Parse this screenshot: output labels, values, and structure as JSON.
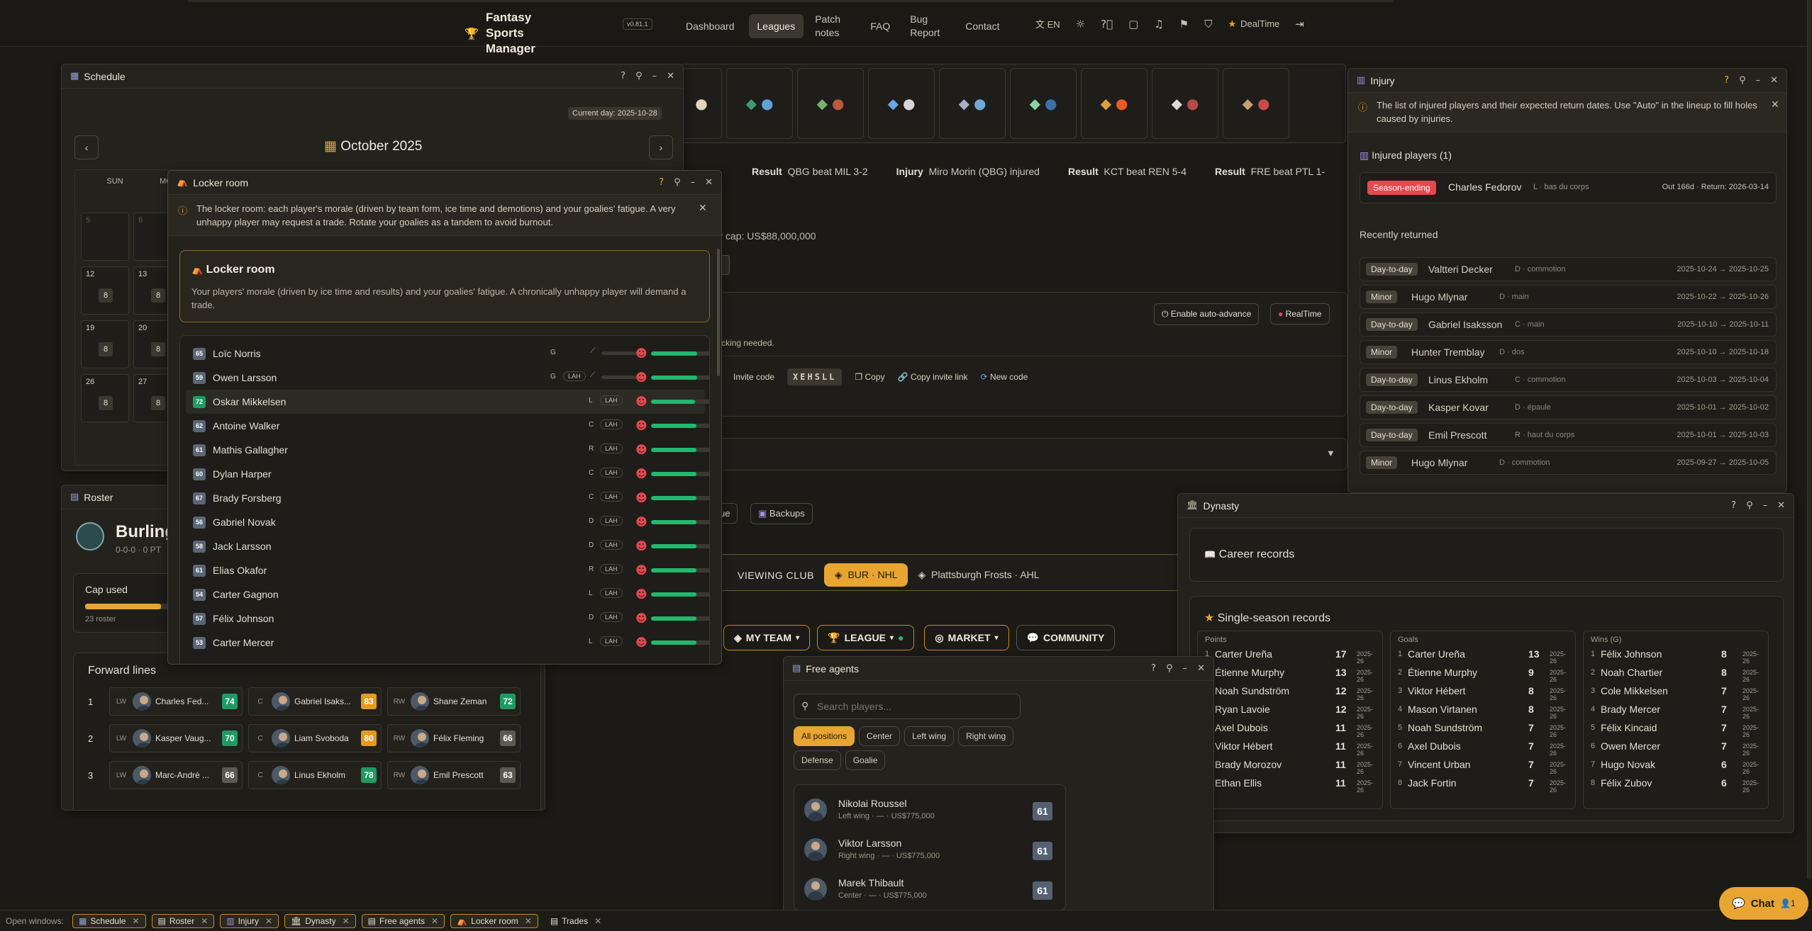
{
  "header": {
    "app_name": "Fantasy Sports Manager",
    "version": "v0.81.1",
    "nav": [
      "Dashboard",
      "Leagues",
      "Patch notes",
      "FAQ",
      "Bug Report",
      "Contact"
    ],
    "active_nav": "Leagues",
    "language": "EN",
    "user_name": "DealTime"
  },
  "background": {
    "news_ticker": [
      {
        "tag": "Result",
        "text": "QBG beat MIL 3-2"
      },
      {
        "tag": "Injury",
        "text": "Miro Morin (QBG) injured"
      },
      {
        "tag": "Result",
        "text": "KCT beat REN 5-4"
      },
      {
        "tag": "Result",
        "text": "FRE beat PTL 1-"
      }
    ],
    "salary_cap": "y cap: US$88,000,000",
    "enable_auto_advance": "Enable auto-advance",
    "realtime": "RealTime",
    "locking_note": "cking needed.",
    "invite_label": "Invite code",
    "invite_code": "XEHSLL",
    "copy": "Copy",
    "copy_invite_link": "Copy invite link",
    "new_code": "New code",
    "backups": "Backups",
    "queue_fragment": "ue",
    "viewing_club_label": "VIEWING CLUB",
    "club_primary": "BUR · NHL",
    "club_secondary": "Plattsburgh Frosts · AHL",
    "tabs": [
      "MY TEAM",
      "LEAGUE",
      "MARKET",
      "COMMUNITY"
    ]
  },
  "schedule": {
    "title": "Schedule",
    "current_day": "Current day: 2025-10-28",
    "month": "October 2025",
    "weekdays": [
      "SUN",
      "MO"
    ],
    "weeks": [
      [
        {
          "d": "5",
          "g": ""
        },
        {
          "d": "6",
          "g": ""
        }
      ],
      [
        {
          "d": "12",
          "g": "8"
        },
        {
          "d": "13",
          "g": "8"
        }
      ],
      [
        {
          "d": "19",
          "g": "8"
        },
        {
          "d": "20",
          "g": "8"
        }
      ],
      [
        {
          "d": "26",
          "g": "8"
        },
        {
          "d": "27",
          "g": "8"
        }
      ]
    ]
  },
  "roster": {
    "title": "Roster",
    "team_name": "Burling",
    "record": "0-0-0 · 0 PT",
    "cap_used_label": "Cap used",
    "cap_used_fraction": 0.58,
    "roster_count": "23 roster",
    "forward_lines_label": "Forward lines",
    "lines": [
      {
        "n": "1",
        "slots": [
          {
            "pos": "LW",
            "name": "Charles Fed...",
            "ovr": "74",
            "c": "green"
          },
          {
            "pos": "C",
            "name": "Gabriel Isaks...",
            "ovr": "83",
            "c": "orange"
          },
          {
            "pos": "RW",
            "name": "Shane Zeman",
            "ovr": "72",
            "c": "green"
          }
        ]
      },
      {
        "n": "2",
        "slots": [
          {
            "pos": "LW",
            "name": "Kasper Vaug...",
            "ovr": "70",
            "c": "green"
          },
          {
            "pos": "C",
            "name": "Liam Svoboda",
            "ovr": "80",
            "c": "orange"
          },
          {
            "pos": "RW",
            "name": "Félix Fleming",
            "ovr": "66",
            "c": "gray"
          }
        ]
      },
      {
        "n": "3",
        "slots": [
          {
            "pos": "LW",
            "name": "Marc-André ...",
            "ovr": "66",
            "c": "gray"
          },
          {
            "pos": "C",
            "name": "Linus Ekholm",
            "ovr": "78",
            "c": "green"
          },
          {
            "pos": "RW",
            "name": "Emil Prescott",
            "ovr": "63",
            "c": "gray"
          }
        ]
      }
    ]
  },
  "locker": {
    "title": "Locker room",
    "info": "The locker room: each player's morale (driven by team form, ice time and demotions) and your goalies' fatigue. A very unhappy player may request a trade. Rotate your goalies as a tandem to avoid burnout.",
    "card_title": "Locker room",
    "card_text": "Your players' morale (driven by ice time and results) and your goalies' fatigue. A chronically unhappy player will demand a trade.",
    "players": [
      {
        "ovr": "65",
        "name": "Loïc Norris",
        "pos": "G",
        "lah": "",
        "fatigue": true,
        "morale": 0.75
      },
      {
        "ovr": "59",
        "name": "Owen Larsson",
        "pos": "G",
        "lah": "LAH",
        "fatigue": true,
        "morale": 0.75
      },
      {
        "ovr": "72",
        "name": "Oskar Mikkelsen",
        "pos": "L",
        "lah": "LAH",
        "fatigue": false,
        "morale": 0.72,
        "hl": true
      },
      {
        "ovr": "62",
        "name": "Antoine Walker",
        "pos": "C",
        "lah": "LAH",
        "fatigue": false,
        "morale": 0.74
      },
      {
        "ovr": "61",
        "name": "Mathis Gallagher",
        "pos": "R",
        "lah": "LAH",
        "fatigue": false,
        "morale": 0.74
      },
      {
        "ovr": "60",
        "name": "Dylan Harper",
        "pos": "C",
        "lah": "LAH",
        "fatigue": false,
        "morale": 0.74
      },
      {
        "ovr": "67",
        "name": "Brady Forsberg",
        "pos": "C",
        "lah": "LAH",
        "fatigue": false,
        "morale": 0.74
      },
      {
        "ovr": "56",
        "name": "Gabriel Novak",
        "pos": "D",
        "lah": "LAH",
        "fatigue": false,
        "morale": 0.74
      },
      {
        "ovr": "58",
        "name": "Jack Larsson",
        "pos": "D",
        "lah": "LAH",
        "fatigue": false,
        "morale": 0.74
      },
      {
        "ovr": "61",
        "name": "Elias Okafor",
        "pos": "R",
        "lah": "LAH",
        "fatigue": false,
        "morale": 0.74
      },
      {
        "ovr": "54",
        "name": "Carter Gagnon",
        "pos": "L",
        "lah": "LAH",
        "fatigue": false,
        "morale": 0.74
      },
      {
        "ovr": "57",
        "name": "Félix Johnson",
        "pos": "D",
        "lah": "LAH",
        "fatigue": false,
        "morale": 0.74
      },
      {
        "ovr": "53",
        "name": "Carter Mercer",
        "pos": "L",
        "lah": "LAH",
        "fatigue": false,
        "morale": 0.74
      }
    ]
  },
  "injury": {
    "title": "Injury",
    "info": "The list of injured players and their expected return dates. Use \"Auto\" in the lineup to fill holes caused by injuries.",
    "injured_header": "Injured players (1)",
    "injured": [
      {
        "status": "Season-ending",
        "name": "Charles Fedorov",
        "detail": "L · bas du corps",
        "out": "Out 166d · Return: 2026-03-14"
      }
    ],
    "recent_header": "Recently returned",
    "recent": [
      {
        "status": "Day-to-day",
        "name": "Valtteri Decker",
        "detail": "D · commotion",
        "dates": "2025-10-24 → 2025-10-25"
      },
      {
        "status": "Minor",
        "name": "Hugo Mlynar",
        "detail": "D · main",
        "dates": "2025-10-22 → 2025-10-26"
      },
      {
        "status": "Day-to-day",
        "name": "Gabriel Isaksson",
        "detail": "C · main",
        "dates": "2025-10-10 → 2025-10-11"
      },
      {
        "status": "Minor",
        "name": "Hunter Tremblay",
        "detail": "D · dos",
        "dates": "2025-10-10 → 2025-10-18"
      },
      {
        "status": "Day-to-day",
        "name": "Linus Ekholm",
        "detail": "C · commotion",
        "dates": "2025-10-03 → 2025-10-04"
      },
      {
        "status": "Day-to-day",
        "name": "Kasper Kovar",
        "detail": "D · épaule",
        "dates": "2025-10-01 → 2025-10-02"
      },
      {
        "status": "Day-to-day",
        "name": "Emil Prescott",
        "detail": "R · haut du corps",
        "dates": "2025-10-01 → 2025-10-03"
      },
      {
        "status": "Minor",
        "name": "Hugo Mlynar",
        "detail": "D · commotion",
        "dates": "2025-09-27 → 2025-10-05"
      }
    ]
  },
  "dynasty": {
    "title": "Dynasty",
    "career_records": "Career records",
    "single_season": "Single-season records",
    "columns": [
      {
        "title": "Points",
        "rows": [
          [
            "1",
            "Carter Ureña",
            "17",
            "2025-26"
          ],
          [
            "2",
            "Étienne Murphy",
            "13",
            "2025-26"
          ],
          [
            "3",
            "Noah Sundström",
            "12",
            "2025-26"
          ],
          [
            "4",
            "Ryan Lavoie",
            "12",
            "2025-26"
          ],
          [
            "5",
            "Axel Dubois",
            "11",
            "2025-26"
          ],
          [
            "6",
            "Viktor Hébert",
            "11",
            "2025-26"
          ],
          [
            "7",
            "Brady Morozov",
            "11",
            "2025-26"
          ],
          [
            "8",
            "Ethan Ellis",
            "11",
            "2025-26"
          ]
        ]
      },
      {
        "title": "Goals",
        "rows": [
          [
            "1",
            "Carter Ureña",
            "13",
            "2025-26"
          ],
          [
            "2",
            "Étienne Murphy",
            "9",
            "2025-26"
          ],
          [
            "3",
            "Viktor Hébert",
            "8",
            "2025-26"
          ],
          [
            "4",
            "Mason Virtanen",
            "8",
            "2025-26"
          ],
          [
            "5",
            "Noah Sundström",
            "7",
            "2025-26"
          ],
          [
            "6",
            "Axel Dubois",
            "7",
            "2025-26"
          ],
          [
            "7",
            "Vincent Urban",
            "7",
            "2025-26"
          ],
          [
            "8",
            "Jack Fortin",
            "7",
            "2025-26"
          ]
        ]
      },
      {
        "title": "Wins (G)",
        "rows": [
          [
            "1",
            "Félix Johnson",
            "8",
            "2025-26"
          ],
          [
            "2",
            "Noah Chartier",
            "8",
            "2025-26"
          ],
          [
            "3",
            "Cole Mikkelsen",
            "7",
            "2025-26"
          ],
          [
            "4",
            "Brady Mercer",
            "7",
            "2025-26"
          ],
          [
            "5",
            "Félix Kincaid",
            "7",
            "2025-26"
          ],
          [
            "6",
            "Owen Mercer",
            "7",
            "2025-26"
          ],
          [
            "7",
            "Hugo Novak",
            "6",
            "2025-26"
          ],
          [
            "8",
            "Félix Zubov",
            "6",
            "2025-26"
          ]
        ]
      }
    ]
  },
  "free_agents": {
    "title": "Free agents",
    "search_placeholder": "Search players...",
    "filters": [
      "All positions",
      "Center",
      "Left wing",
      "Right wing",
      "Defense",
      "Goalie"
    ],
    "players": [
      {
        "name": "Nikolai Roussel",
        "detail": "Left wing · — · US$775,000",
        "ovr": "61"
      },
      {
        "name": "Viktor Larsson",
        "detail": "Right wing · — · US$775,000",
        "ovr": "61"
      },
      {
        "name": "Marek Thibault",
        "detail": "Center · — · US$775,000",
        "ovr": "61"
      }
    ]
  },
  "taskbar": {
    "label": "Open windows:",
    "items": [
      "Schedule",
      "Roster",
      "Injury",
      "Dynasty",
      "Free agents",
      "Locker room",
      "Trades"
    ]
  },
  "chat": {
    "label": "Chat",
    "count": "1"
  }
}
